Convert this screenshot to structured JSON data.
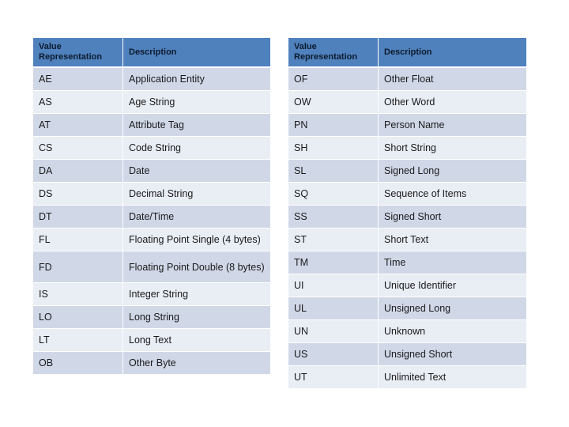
{
  "left_table": {
    "headers": [
      "Value Representation",
      "Description"
    ],
    "rows": [
      {
        "code": "AE",
        "description": "Application Entity"
      },
      {
        "code": "AS",
        "description": "Age String"
      },
      {
        "code": "AT",
        "description": "Attribute Tag"
      },
      {
        "code": "CS",
        "description": "Code String"
      },
      {
        "code": "DA",
        "description": "Date"
      },
      {
        "code": "DS",
        "description": "Decimal String"
      },
      {
        "code": "DT",
        "description": "Date/Time"
      },
      {
        "code": "FL",
        "description": "Floating Point Single (4 bytes)"
      },
      {
        "code": "FD",
        "description": "Floating Point Double (8 bytes)"
      },
      {
        "code": "IS",
        "description": "Integer String"
      },
      {
        "code": "LO",
        "description": "Long String"
      },
      {
        "code": "LT",
        "description": "Long Text"
      },
      {
        "code": "OB",
        "description": "Other Byte"
      }
    ]
  },
  "right_table": {
    "headers": [
      "Value Representation",
      "Description"
    ],
    "rows": [
      {
        "code": "OF",
        "description": "Other Float"
      },
      {
        "code": "OW",
        "description": "Other Word"
      },
      {
        "code": "PN",
        "description": "Person Name"
      },
      {
        "code": "SH",
        "description": "Short String"
      },
      {
        "code": "SL",
        "description": "Signed Long"
      },
      {
        "code": "SQ",
        "description": "Sequence of Items"
      },
      {
        "code": "SS",
        "description": "Signed Short"
      },
      {
        "code": "ST",
        "description": "Short Text"
      },
      {
        "code": "TM",
        "description": "Time"
      },
      {
        "code": "UI",
        "description": "Unique Identifier"
      },
      {
        "code": "UL",
        "description": "Unsigned Long"
      },
      {
        "code": "UN",
        "description": "Unknown"
      },
      {
        "code": "US",
        "description": "Unsigned Short"
      },
      {
        "code": "UT",
        "description": "Unlimited Text"
      }
    ]
  },
  "colors": {
    "header_bg": "#4f81bd",
    "row_dark": "#d0d8e8",
    "row_light": "#e9edf4"
  }
}
